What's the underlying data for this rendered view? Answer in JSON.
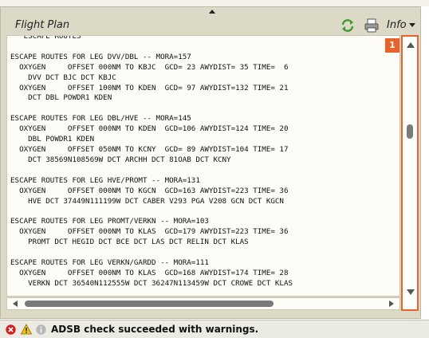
{
  "panel": {
    "title": "Flight Plan",
    "info_menu_label": "Info",
    "icons": {
      "refresh": "refresh-icon",
      "print": "printer-icon",
      "collapse": "collapse-up-icon"
    }
  },
  "annotation": {
    "badge_number": "1",
    "highlight_color": "#e8622a"
  },
  "escape_text": {
    "lines": [
      "   ESCAPE ROUTES",
      "",
      "ESCAPE ROUTES FOR LEG DVV/DBL -- MORA=157",
      "  OXYGEN     OFFSET 000NM TO KBJC  GCD= 23 AWYDIST= 35 TIME=  6",
      "    DVV DCT BJC DCT KBJC",
      "  OXYGEN     OFFSET 100NM TO KDEN  GCD= 97 AWYDIST=132 TIME= 21",
      "    DCT DBL POWDR1 KDEN",
      "",
      "ESCAPE ROUTES FOR LEG DBL/HVE -- MORA=145",
      "  OXYGEN     OFFSET 000NM TO KDEN  GCD=106 AWYDIST=124 TIME= 20",
      "    DBL POWDR1 KDEN",
      "  OXYGEN     OFFSET 050NM TO KCNY  GCD= 89 AWYDIST=104 TIME= 17",
      "    DCT 38569N108569W DCT ARCHH DCT 81OAB DCT KCNY",
      "",
      "ESCAPE ROUTES FOR LEG HVE/PROMT -- MORA=131",
      "  OXYGEN     OFFSET 000NM TO KGCN  GCD=163 AWYDIST=223 TIME= 36",
      "    HVE DCT 37449N111199W DCT CABER V293 PGA V208 GCN DCT KGCN",
      "",
      "ESCAPE ROUTES FOR LEG PROMT/VERKN -- MORA=103",
      "  OXYGEN     OFFSET 000NM TO KLAS  GCD=179 AWYDIST=223 TIME= 36",
      "    PROMT DCT HEGID DCT BCE DCT LAS DCT RELIN DCT KLAS",
      "",
      "ESCAPE ROUTES FOR LEG VERKN/GARDD -- MORA=111",
      "  OXYGEN     OFFSET 000NM TO KLAS  GCD=168 AWYDIST=174 TIME= 28",
      "    VERKN DCT 36540N112555W DCT 36247N113459W DCT CROWE DCT KLAS"
    ]
  },
  "status": {
    "message": "ADSB check succeeded with warnings.",
    "icons": [
      "error-icon",
      "warning-icon",
      "info-icon"
    ]
  }
}
